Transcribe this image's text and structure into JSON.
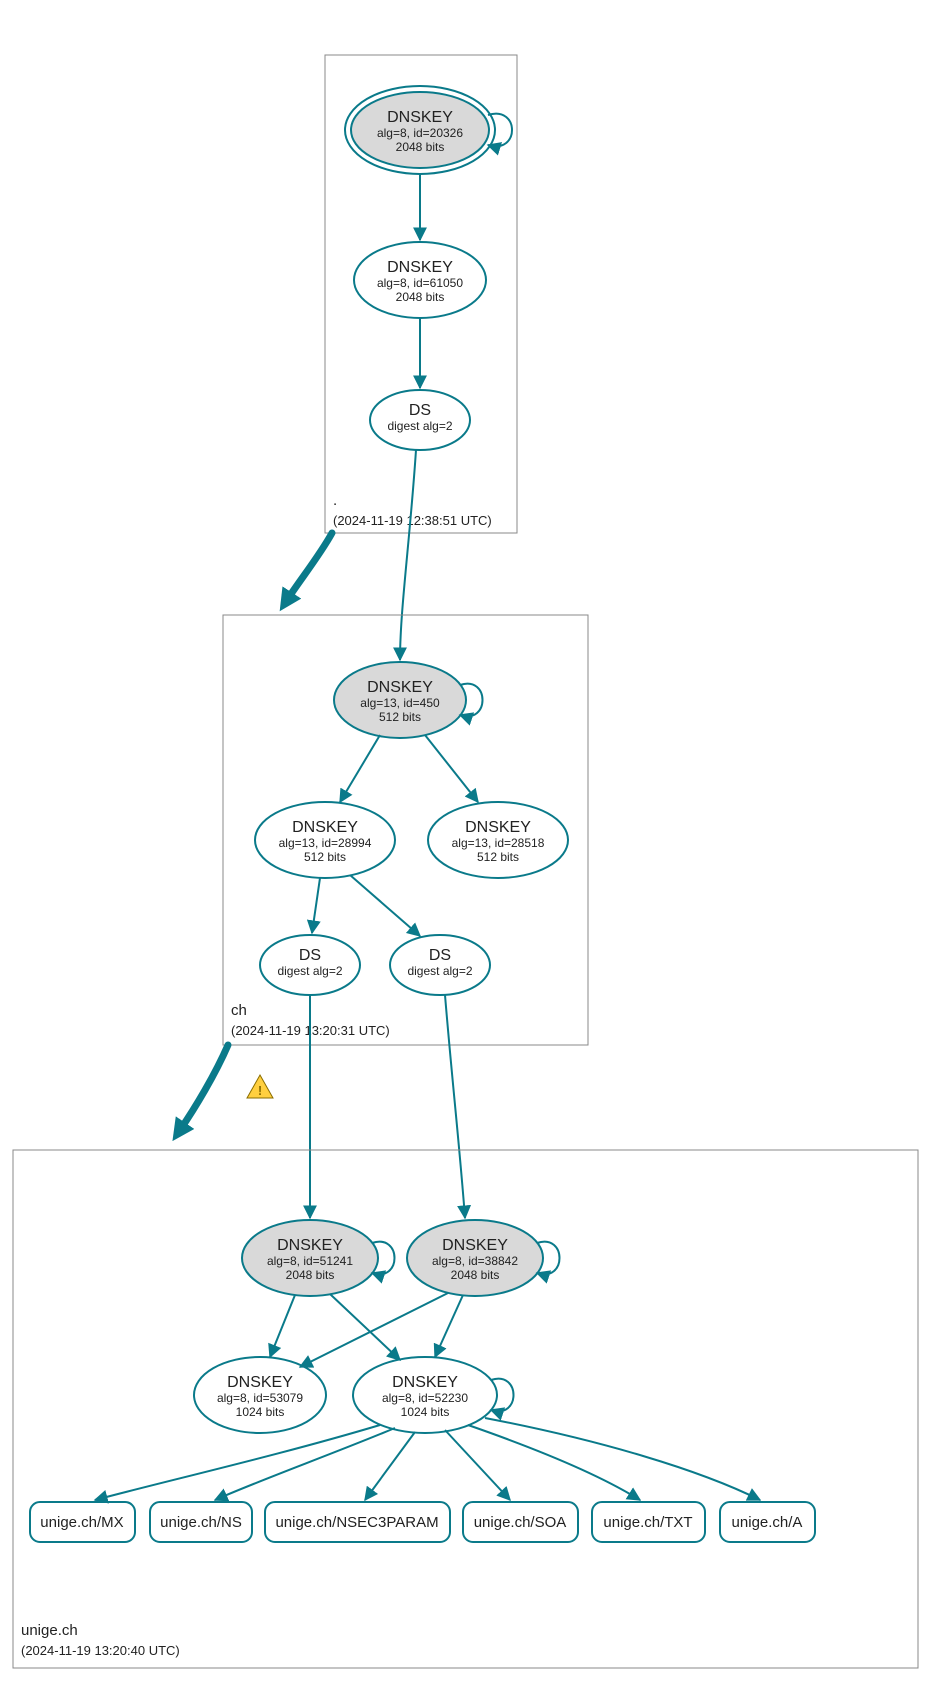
{
  "colors": {
    "accent": "#0a7a8a",
    "zone_border": "#888888",
    "node_fill_grey": "#d9d9d9",
    "warning": "#ffcf3f"
  },
  "zones": {
    "root": {
      "label": ".",
      "timestamp": "(2024-11-19 12:38:51 UTC)",
      "nodes": {
        "dnskey_ksk": {
          "title": "DNSKEY",
          "line1": "alg=8, id=20326",
          "line2": "2048 bits"
        },
        "dnskey_zsk": {
          "title": "DNSKEY",
          "line1": "alg=8, id=61050",
          "line2": "2048 bits"
        },
        "ds": {
          "title": "DS",
          "line1": "digest alg=2"
        }
      }
    },
    "ch": {
      "label": "ch",
      "timestamp": "(2024-11-19 13:20:31 UTC)",
      "nodes": {
        "dnskey_ksk": {
          "title": "DNSKEY",
          "line1": "alg=13, id=450",
          "line2": "512 bits"
        },
        "dnskey_zsk1": {
          "title": "DNSKEY",
          "line1": "alg=13, id=28994",
          "line2": "512 bits"
        },
        "dnskey_zsk2": {
          "title": "DNSKEY",
          "line1": "alg=13, id=28518",
          "line2": "512 bits"
        },
        "ds1": {
          "title": "DS",
          "line1": "digest alg=2"
        },
        "ds2": {
          "title": "DS",
          "line1": "digest alg=2"
        }
      }
    },
    "unige": {
      "label": "unige.ch",
      "timestamp": "(2024-11-19 13:20:40 UTC)",
      "nodes": {
        "dnskey_ksk1": {
          "title": "DNSKEY",
          "line1": "alg=8, id=51241",
          "line2": "2048 bits"
        },
        "dnskey_ksk2": {
          "title": "DNSKEY",
          "line1": "alg=8, id=38842",
          "line2": "2048 bits"
        },
        "dnskey_zsk1": {
          "title": "DNSKEY",
          "line1": "alg=8, id=53079",
          "line2": "1024 bits"
        },
        "dnskey_zsk2": {
          "title": "DNSKEY",
          "line1": "alg=8, id=52230",
          "line2": "1024 bits"
        }
      },
      "leaves": {
        "mx": "unige.ch/MX",
        "ns": "unige.ch/NS",
        "nsec3param": "unige.ch/NSEC3PARAM",
        "soa": "unige.ch/SOA",
        "txt": "unige.ch/TXT",
        "a": "unige.ch/A"
      }
    }
  },
  "edges_within": [
    {
      "from": "root.dnskey_ksk",
      "to": "root.dnskey_ksk",
      "self": true
    },
    {
      "from": "root.dnskey_ksk",
      "to": "root.dnskey_zsk"
    },
    {
      "from": "root.dnskey_zsk",
      "to": "root.ds"
    },
    {
      "from": "ch.dnskey_ksk",
      "to": "ch.dnskey_ksk",
      "self": true
    },
    {
      "from": "ch.dnskey_ksk",
      "to": "ch.dnskey_zsk1"
    },
    {
      "from": "ch.dnskey_ksk",
      "to": "ch.dnskey_zsk2"
    },
    {
      "from": "ch.dnskey_zsk1",
      "to": "ch.ds1"
    },
    {
      "from": "ch.dnskey_zsk1",
      "to": "ch.ds2"
    },
    {
      "from": "unige.dnskey_ksk1",
      "to": "unige.dnskey_ksk1",
      "self": true
    },
    {
      "from": "unige.dnskey_ksk2",
      "to": "unige.dnskey_ksk2",
      "self": true
    },
    {
      "from": "unige.dnskey_zsk2",
      "to": "unige.dnskey_zsk2",
      "self": true
    },
    {
      "from": "unige.dnskey_ksk1",
      "to": "unige.dnskey_zsk1"
    },
    {
      "from": "unige.dnskey_ksk1",
      "to": "unige.dnskey_zsk2"
    },
    {
      "from": "unige.dnskey_ksk2",
      "to": "unige.dnskey_zsk1"
    },
    {
      "from": "unige.dnskey_ksk2",
      "to": "unige.dnskey_zsk2"
    },
    {
      "from": "unige.dnskey_zsk2",
      "to": "unige.leaves.mx"
    },
    {
      "from": "unige.dnskey_zsk2",
      "to": "unige.leaves.ns"
    },
    {
      "from": "unige.dnskey_zsk2",
      "to": "unige.leaves.nsec3param"
    },
    {
      "from": "unige.dnskey_zsk2",
      "to": "unige.leaves.soa"
    },
    {
      "from": "unige.dnskey_zsk2",
      "to": "unige.leaves.txt"
    },
    {
      "from": "unige.dnskey_zsk2",
      "to": "unige.leaves.a"
    }
  ],
  "edges_cross_zone": [
    {
      "from": "root.ds",
      "to": "ch.dnskey_ksk"
    },
    {
      "from": "ch.ds1",
      "to": "unige.dnskey_ksk1"
    },
    {
      "from": "ch.ds2",
      "to": "unige.dnskey_ksk2"
    }
  ],
  "delegation_edges": [
    {
      "from_zone": "root",
      "to_zone": "ch",
      "warning": false
    },
    {
      "from_zone": "ch",
      "to_zone": "unige",
      "warning": true
    }
  ]
}
